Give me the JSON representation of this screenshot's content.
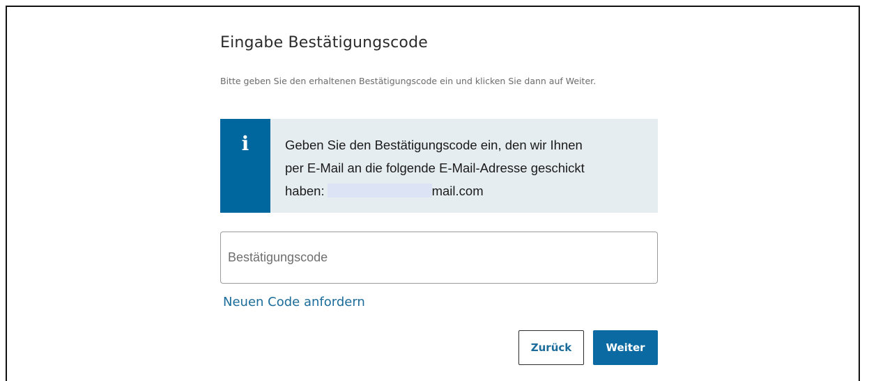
{
  "page": {
    "title": "Eingabe Bestätigungscode",
    "instruction": "Bitte geben Sie den erhaltenen Bestätigungscode ein und klicken Sie dann auf Weiter."
  },
  "info": {
    "icon": "info-icon",
    "text_line1": "Geben Sie den Bestätigungscode ein, den wir Ihnen",
    "text_line2": "per E-Mail an die folgende E-Mail-Adresse geschickt",
    "text_prefix": "haben:",
    "email_suffix": "mail.com",
    "stripe_color": "#00679e",
    "background_color": "#e6edf1"
  },
  "form": {
    "code_placeholder": "Bestätigungscode",
    "code_value": "",
    "new_code_link": "Neuen Code anfordern",
    "back_label": "Zurück",
    "next_label": "Weiter"
  },
  "colors": {
    "accent": "#0a6aa1",
    "link": "#1b6c9a"
  }
}
